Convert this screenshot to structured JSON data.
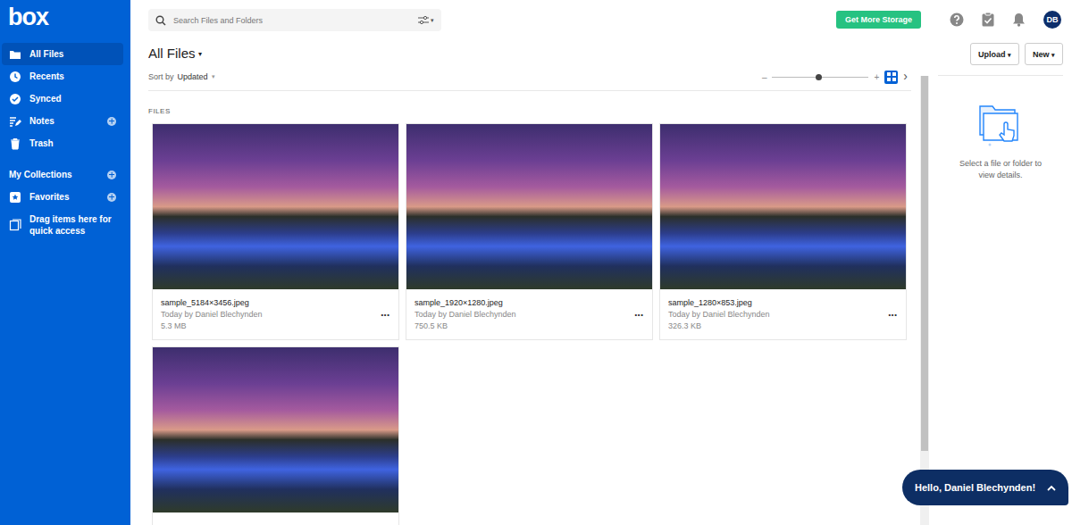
{
  "sidebar": {
    "logo": "box",
    "items": [
      {
        "label": "All Files",
        "icon": "folder",
        "selected": true,
        "has_add": false
      },
      {
        "label": "Recents",
        "icon": "clock",
        "selected": false,
        "has_add": false
      },
      {
        "label": "Synced",
        "icon": "check",
        "selected": false,
        "has_add": false
      },
      {
        "label": "Notes",
        "icon": "notes",
        "selected": false,
        "has_add": true
      },
      {
        "label": "Trash",
        "icon": "trash",
        "selected": false,
        "has_add": false
      }
    ],
    "collections": [
      {
        "label": "My Collections",
        "icon": "collection",
        "has_add": true
      },
      {
        "label": "Favorites",
        "icon": "favorite",
        "has_add": true
      }
    ],
    "drop_hint": "Drag items here for quick access"
  },
  "topbar": {
    "search": {
      "placeholder": "Search Files and Folders",
      "filter_caret": "▾"
    },
    "storage_button": "Get More Storage",
    "avatar": "DB"
  },
  "header": {
    "title": "All Files",
    "title_caret": "▾",
    "sort_label": "Sort by",
    "sort_value": "Updated",
    "sort_caret": "▾",
    "zoom": {
      "minus": "–",
      "plus": "+",
      "level": 0.48
    },
    "views": [
      {
        "name": "grid",
        "selected": true
      }
    ],
    "next": "›"
  },
  "actions": [
    {
      "label": "Upload",
      "caret": "▾"
    },
    {
      "label": "New",
      "caret": "▾"
    }
  ],
  "section_label": "FILES",
  "files": [
    {
      "kind": "full",
      "name": "sample_5184×3456.jpeg",
      "meta": "Today by Daniel Blechynden",
      "size": "5.3 MB",
      "more": "···"
    },
    {
      "kind": "full",
      "name": "sample_1920×1280.jpeg",
      "meta": "Today by Daniel Blechynden",
      "size": "750.5 KB",
      "more": "···"
    },
    {
      "kind": "full",
      "name": "sample_1280×853.jpeg",
      "meta": "Today by Daniel Blechynden",
      "size": "326.3 KB",
      "more": "···"
    },
    {
      "kind": "cut",
      "name": "",
      "meta": "",
      "size": "",
      "more": ""
    }
  ],
  "details": {
    "hint": "Select a file or folder to view details."
  },
  "chat": {
    "greeting": "Hello, Daniel Blechynden!"
  }
}
